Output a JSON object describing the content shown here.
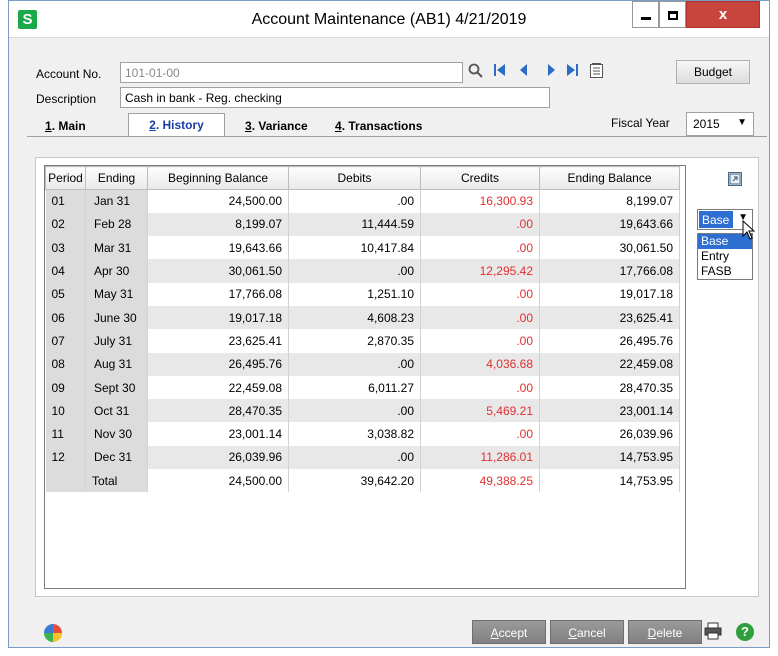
{
  "window": {
    "title": "Account Maintenance (AB1) 4/21/2019",
    "app_icon": "S",
    "close": "x"
  },
  "account": {
    "no_label": "Account No.",
    "no_value": "101-01-00",
    "desc_label": "Description",
    "desc_value": "Cash in bank - Reg. checking",
    "budget_button": "Budget"
  },
  "tabs": [
    {
      "num": "1",
      "label": ". Main"
    },
    {
      "num": "2",
      "label": ". History"
    },
    {
      "num": "3",
      "label": ". Variance"
    },
    {
      "num": "4",
      "label": ". Transactions"
    }
  ],
  "fiscal": {
    "label": "Fiscal Year",
    "value": "2015"
  },
  "table": {
    "headers": [
      "Period",
      "Ending",
      "Beginning Balance",
      "Debits",
      "Credits",
      "Ending Balance"
    ],
    "rows": [
      [
        "01",
        "Jan 31",
        "24,500.00",
        ".00",
        "16,300.93",
        "8,199.07"
      ],
      [
        "02",
        "Feb 28",
        "8,199.07",
        "11,444.59",
        ".00",
        "19,643.66"
      ],
      [
        "03",
        "Mar 31",
        "19,643.66",
        "10,417.84",
        ".00",
        "30,061.50"
      ],
      [
        "04",
        "Apr 30",
        "30,061.50",
        ".00",
        "12,295.42",
        "17,766.08"
      ],
      [
        "05",
        "May 31",
        "17,766.08",
        "1,251.10",
        ".00",
        "19,017.18"
      ],
      [
        "06",
        "June 30",
        "19,017.18",
        "4,608.23",
        ".00",
        "23,625.41"
      ],
      [
        "07",
        "July 31",
        "23,625.41",
        "2,870.35",
        ".00",
        "26,495.76"
      ],
      [
        "08",
        "Aug 31",
        "26,495.76",
        ".00",
        "4,036.68",
        "22,459.08"
      ],
      [
        "09",
        "Sept 30",
        "22,459.08",
        "6,011.27",
        ".00",
        "28,470.35"
      ],
      [
        "10",
        "Oct 31",
        "28,470.35",
        ".00",
        "5,469.21",
        "23,001.14"
      ],
      [
        "11",
        "Nov 30",
        "23,001.14",
        "3,038.82",
        ".00",
        "26,039.96"
      ],
      [
        "12",
        "Dec 31",
        "26,039.96",
        ".00",
        "11,286.01",
        "14,753.95"
      ]
    ],
    "total": [
      "",
      "Total",
      "24,500.00",
      "39,642.20",
      "49,388.25",
      "14,753.95"
    ]
  },
  "basis_dropdown": {
    "selected": "Base",
    "options": [
      "Base",
      "Entry",
      "FASB"
    ]
  },
  "buttons": {
    "accept_u": "A",
    "accept_rest": "ccept",
    "cancel_u": "C",
    "cancel_rest": "ancel",
    "delete_u": "D",
    "delete_rest": "elete"
  },
  "colors": {
    "accent": "#2d6ed1",
    "credit_red": "#e03030",
    "tab_active": "#1a3ea8"
  }
}
